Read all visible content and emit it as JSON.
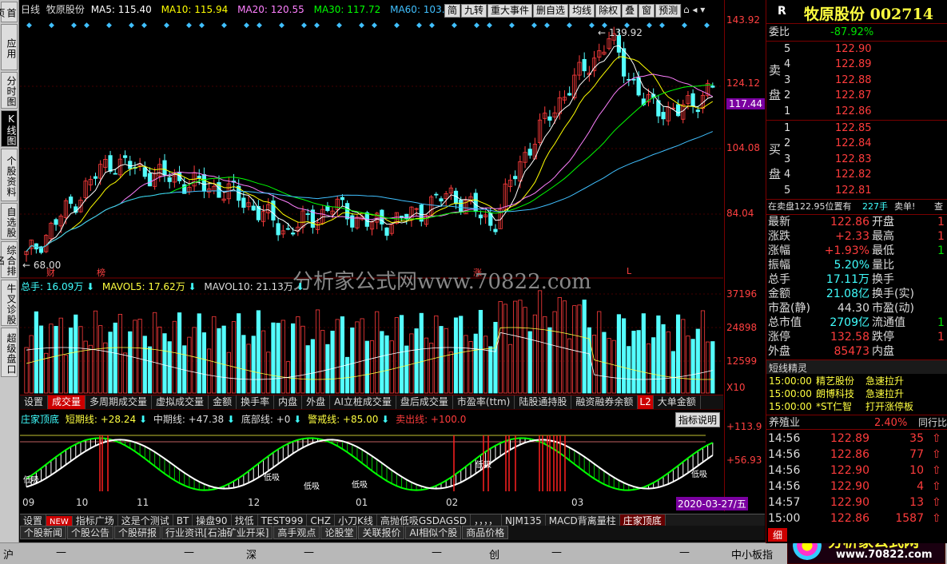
{
  "left_tabs": [
    "首页",
    "应用",
    "分时图",
    "K线图",
    "个股资料",
    "自选股",
    "综合排名",
    "牛叉诊股",
    "超级盘口"
  ],
  "header": {
    "period": "日线",
    "name": "牧原股份",
    "ma5": "MA5: 115.40",
    "ma10": "MA10: 115.94",
    "ma20": "MA20: 120.55",
    "ma30": "MA30: 117.72",
    "ma60": "MA60: 103."
  },
  "toolbar": [
    "简",
    "九转",
    "重大事件",
    "删自选",
    "均线",
    "除权",
    "叠",
    "窗",
    "预测"
  ],
  "price_axis": [
    "143.92",
    "124.12",
    "104.08",
    "84.04"
  ],
  "price_current": "117.44",
  "price_annot": {
    "high": "139.92",
    "low": "68.00",
    "markers": [
      "财",
      "榜",
      "涨",
      "L"
    ]
  },
  "vol_header": {
    "total": "总手: 16.09万",
    "mavol5": "MAVOL5: 17.62万",
    "mavol10": "MAVOL10: 21.13万"
  },
  "vol_axis": [
    "37196",
    "24898",
    "12599",
    "X10"
  ],
  "ind_tabs": [
    "设置",
    "成交量",
    "多周期成交量",
    "虚拟成交量",
    "金额",
    "换手率",
    "内盘",
    "外盘",
    "AI立桩成交量",
    "盘后成交量",
    "市盈率(ttm)",
    "陆股通持股",
    "融资融券余额",
    "L2",
    "大单金额"
  ],
  "osc_header": {
    "name": "庄家顶底",
    "short": "短期线: +28.24",
    "mid": "中期线: +47.38",
    "bottom": "底部线: +0",
    "warn": "警戒线: +85.00",
    "sell": "卖出线: +100.0",
    "explain": "指标说明"
  },
  "osc_axis": [
    "+113.9",
    "+56.93"
  ],
  "osc_labels": [
    "低吸",
    "低吸",
    "低吸",
    "低吸",
    "低吸"
  ],
  "date_axis": [
    "09",
    "10",
    "11",
    "12",
    "01",
    "02",
    "03"
  ],
  "date_current": "2020-03-27/五",
  "watermark": "分析家公式网www.70822.com",
  "bottom_tabs1": [
    "设置",
    "NEW",
    "指标广场",
    "这是个测试",
    "BT",
    "操盘90",
    "找低",
    "TEST999",
    "CHZ",
    "小刀K线",
    "高抛低吸GSDAGSD",
    "，，，，",
    "NJM135",
    "MACD背离量柱",
    "庄家顶底"
  ],
  "bottom_tabs2": [
    "个股新闻",
    "个股公告",
    "个股研报",
    "行业资讯[石油矿业开采]",
    "高手观点",
    "论股堂",
    "关联报价",
    "AI相似个股",
    "商品价格"
  ],
  "status_bar": {
    "sh": "沪",
    "sz": "深",
    "cy": "创",
    "dash": "—",
    "board": "中小板指",
    "logo": "分析家公式网",
    "logo_url": "www.70822.com"
  },
  "right": {
    "r": "R",
    "title": "牧原股份 002714",
    "webi_label": "委比",
    "webi": "-87.92%",
    "sell_label": [
      "卖",
      "盘"
    ],
    "buy_label": [
      "买",
      "盘"
    ],
    "asks": [
      {
        "n": "5",
        "p": "122.90"
      },
      {
        "n": "4",
        "p": "122.89"
      },
      {
        "n": "3",
        "p": "122.88"
      },
      {
        "n": "2",
        "p": "122.87"
      },
      {
        "n": "1",
        "p": "122.86"
      }
    ],
    "bids": [
      {
        "n": "1",
        "p": "122.85"
      },
      {
        "n": "2",
        "p": "122.84"
      },
      {
        "n": "3",
        "p": "122.83"
      },
      {
        "n": "4",
        "p": "122.82"
      },
      {
        "n": "5",
        "p": "122.81"
      }
    ],
    "notice": "在卖盘122.95位置有",
    "notice_qty": "227手",
    "notice_sell": "卖单!",
    "notice_cha": "查",
    "stats": [
      {
        "l": "最新",
        "v": "122.86",
        "l2": "开盘",
        "v2": "1"
      },
      {
        "l": "涨跌",
        "v": "+2.33",
        "l2": "最高",
        "v2": "1"
      },
      {
        "l": "涨幅",
        "v": "+1.93%",
        "l2": "最低",
        "v2": "1"
      },
      {
        "l": "振幅",
        "v": "5.20%",
        "l2": "量比",
        "v2": ""
      },
      {
        "l": "总手",
        "v": "17.11万",
        "l2": "换手",
        "v2": ""
      },
      {
        "l": "金额",
        "v": "21.08亿",
        "l2": "换手(实)",
        "v2": ""
      },
      {
        "l": "市盈(静)",
        "v": "44.30",
        "l2": "市盈(动)",
        "v2": ""
      },
      {
        "l": "总市值",
        "v": "2709亿",
        "l2": "流通值",
        "v2": "1"
      },
      {
        "l": "涨停",
        "v": "132.58",
        "l2": "跌停",
        "v2": "1"
      },
      {
        "l": "外盘",
        "v": "85473",
        "l2": "内盘",
        "v2": ""
      }
    ],
    "elf_title": "短线精灵",
    "elf": [
      {
        "t": "15:00:00",
        "n": "精艺股份",
        "s": "急速拉升"
      },
      {
        "t": "15:00:00",
        "n": "朗博科技",
        "s": "急速拉升"
      },
      {
        "t": "15:00:00",
        "n": "*ST仁智",
        "s": "打开涨停板"
      }
    ],
    "industry": "养殖业",
    "industry_pct": "2.40%",
    "industry_more": "同行比",
    "ticks": [
      {
        "t": "14:56",
        "p": "122.89",
        "v": "35"
      },
      {
        "t": "14:56",
        "p": "122.86",
        "v": "77"
      },
      {
        "t": "14:56",
        "p": "122.90",
        "v": "10"
      },
      {
        "t": "14:56",
        "p": "122.90",
        "v": "4"
      },
      {
        "t": "14:57",
        "p": "122.90",
        "v": "13"
      },
      {
        "t": "15:00",
        "p": "122.86",
        "v": "1587"
      }
    ],
    "detail_tab": "细"
  },
  "chart_data": {
    "type": "candlestick",
    "title": "牧原股份 日线",
    "ylim": [
      68,
      143.92
    ],
    "close_start": 68,
    "close_end": 122.86,
    "high": 139.92,
    "low": 68.0,
    "ma_colors": {
      "ma5": "#ffffff",
      "ma10": "#ffff00",
      "ma20": "#ff80ff",
      "ma30": "#00ff00",
      "ma60": "#40c0ff"
    },
    "up_color": "#ff3c3c",
    "down_color": "#54ffff"
  }
}
